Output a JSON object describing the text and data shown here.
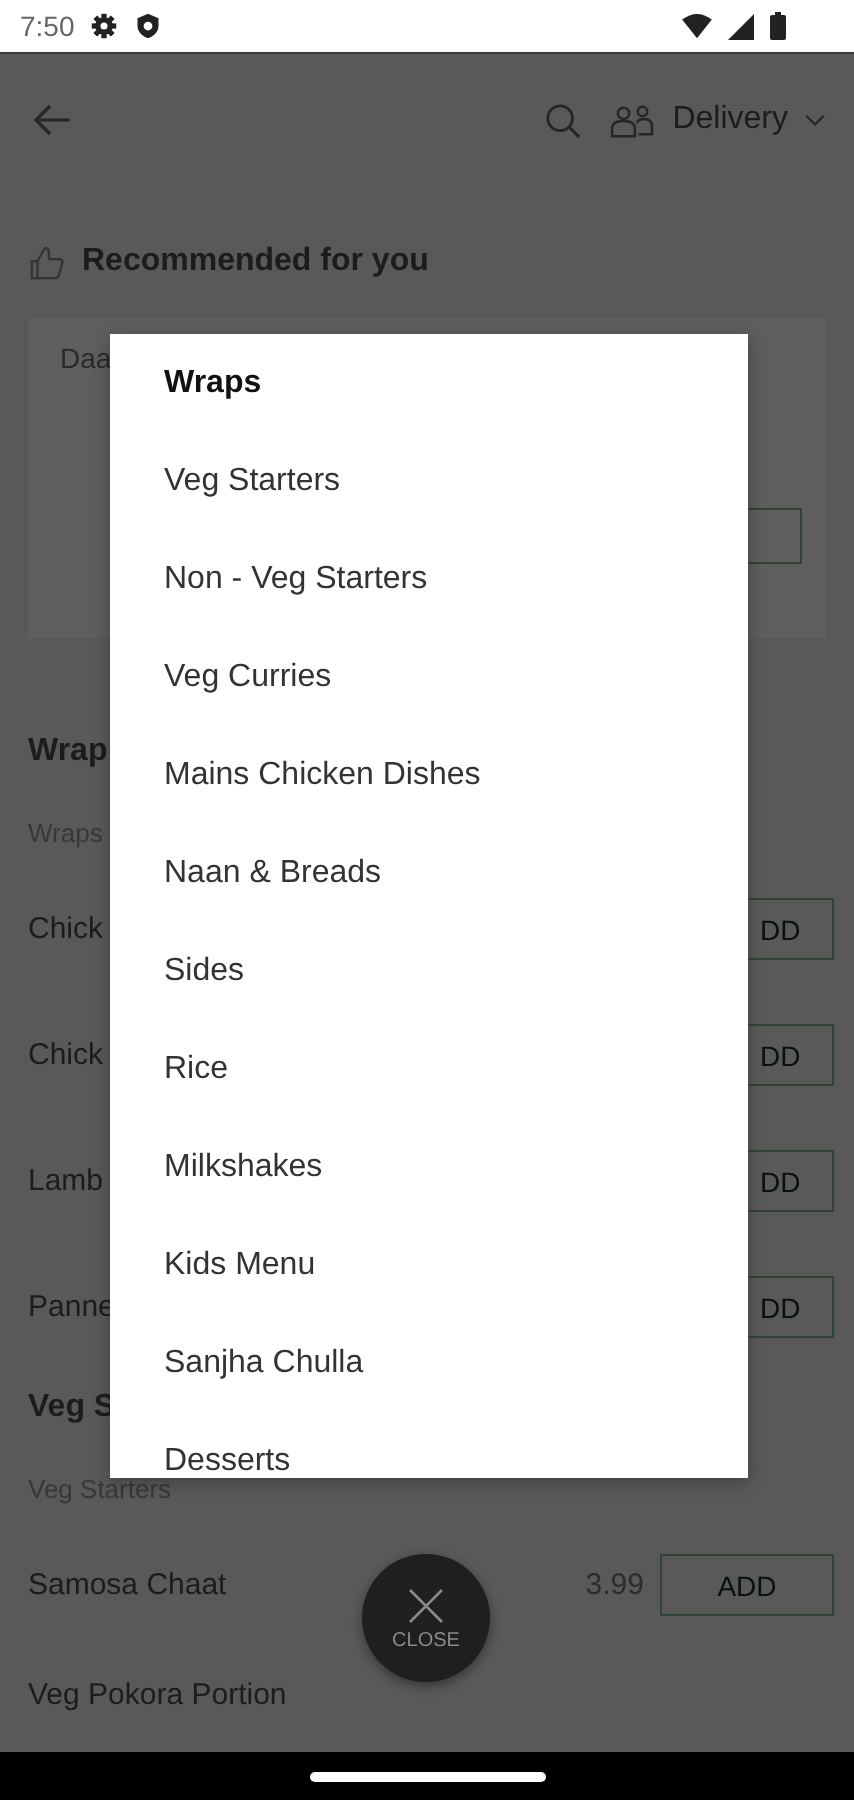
{
  "status_bar": {
    "time": "7:50"
  },
  "header": {
    "mode": "Delivery"
  },
  "recommended": {
    "title": "Recommended for you",
    "card_item": "Daa"
  },
  "sections": [
    {
      "title": "Wrap",
      "subtitle": "Wraps",
      "items": [
        {
          "name": "Chick",
          "kind": "clipped",
          "button": "DD"
        },
        {
          "name": "Chick",
          "kind": "clipped",
          "button": "DD"
        },
        {
          "name": "Lamb",
          "kind": "clipped",
          "button": "DD"
        },
        {
          "name": "Panne",
          "kind": "clipped",
          "button": "DD"
        }
      ]
    },
    {
      "title": "Veg S",
      "subtitle": "Veg Starters",
      "items": [
        {
          "name": "Samosa Chaat",
          "kind": "full",
          "price": "3.99",
          "button": "ADD"
        },
        {
          "name": "Veg Pokora Portion",
          "kind": "plain"
        }
      ]
    }
  ],
  "category_menu": {
    "items": [
      {
        "label": "Wraps",
        "selected": true
      },
      {
        "label": "Veg Starters",
        "selected": false
      },
      {
        "label": "Non - Veg Starters",
        "selected": false
      },
      {
        "label": "Veg Curries",
        "selected": false
      },
      {
        "label": "Mains Chicken Dishes",
        "selected": false
      },
      {
        "label": "Naan & Breads",
        "selected": false
      },
      {
        "label": "Sides",
        "selected": false
      },
      {
        "label": "Rice",
        "selected": false
      },
      {
        "label": "Milkshakes",
        "selected": false
      },
      {
        "label": "Kids Menu",
        "selected": false
      },
      {
        "label": "Sanjha Chulla",
        "selected": false
      },
      {
        "label": "Desserts",
        "selected": false
      }
    ]
  },
  "close_button": {
    "label": "CLOSE"
  }
}
